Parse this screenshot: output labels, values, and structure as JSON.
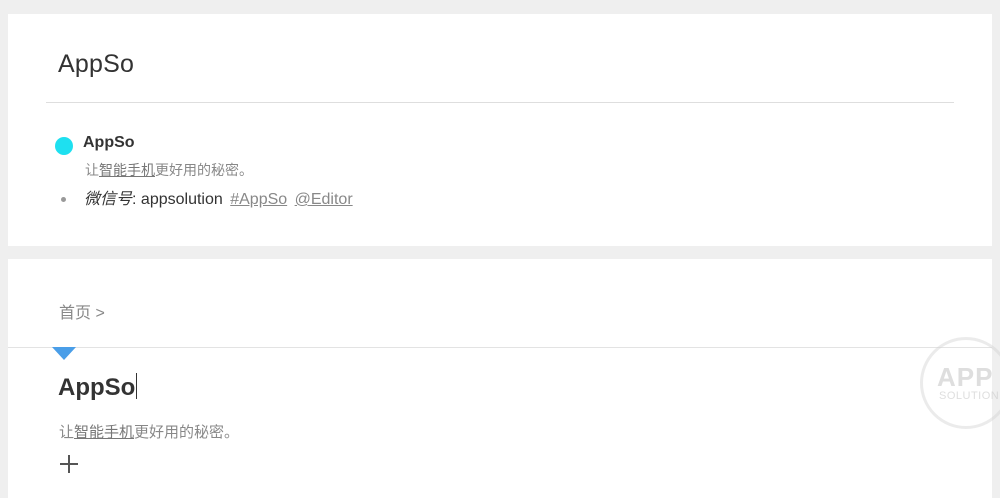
{
  "top_card": {
    "title": "AppSo",
    "profile": {
      "name": "AppSo",
      "desc_prefix": "让",
      "desc_link": "智能手机",
      "desc_suffix": "更好用的秘密。"
    },
    "wechat": {
      "label": "微信号",
      "separator": ":",
      "id": "appsolution",
      "tag_link": "#AppSo",
      "mention_link": "@Editor"
    }
  },
  "bottom_card": {
    "breadcrumb": "首页 >",
    "title": "AppSo",
    "desc_prefix": "让",
    "desc_link": "智能手机",
    "desc_suffix": "更好用的秘密。",
    "add_icon": "plus-icon"
  },
  "annotation": {
    "arrow_color_start": "#1ee0f0",
    "arrow_color_end": "#4a9ee8"
  },
  "watermark": {
    "main": "APP",
    "sub": "SOLUTION"
  }
}
